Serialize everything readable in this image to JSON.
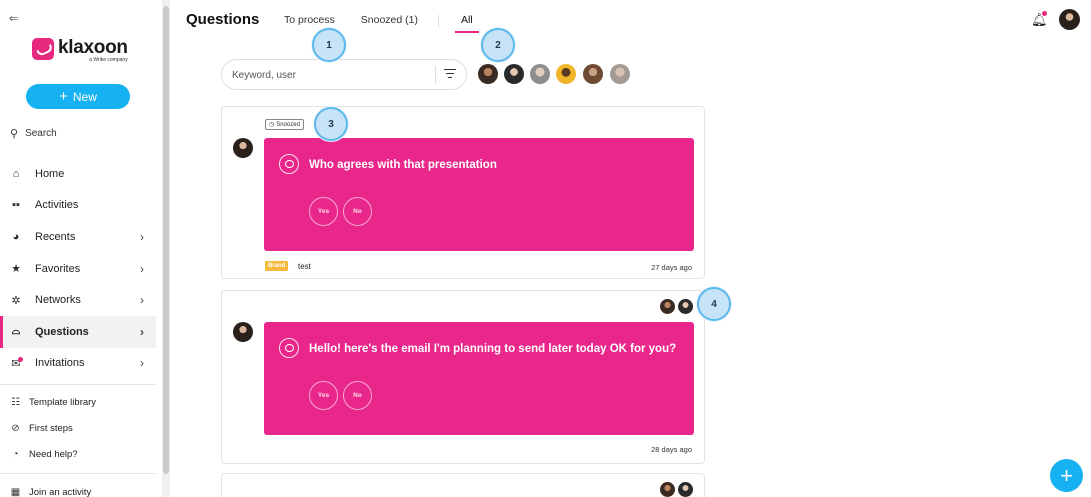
{
  "sidebar": {
    "collapse_icon": "collapse-left-icon",
    "logo": {
      "word": "klaxoon",
      "sub": "a Wrike company"
    },
    "new_label": "New",
    "search_label": "Search",
    "items": [
      {
        "label": "Home",
        "icon": "home-icon",
        "chevron": false
      },
      {
        "label": "Activities",
        "icon": "activities-icon",
        "chevron": false
      },
      {
        "label": "Recents",
        "icon": "clock-icon",
        "chevron": true
      },
      {
        "label": "Favorites",
        "icon": "star-icon",
        "chevron": true
      },
      {
        "label": "Networks",
        "icon": "network-icon",
        "chevron": true
      },
      {
        "label": "Questions",
        "icon": "inbox-icon",
        "chevron": true,
        "active": true
      },
      {
        "label": "Invitations",
        "icon": "envelope-icon",
        "chevron": true
      }
    ],
    "secondary": [
      {
        "label": "Template library",
        "icon": "template-icon"
      },
      {
        "label": "First steps",
        "icon": "compass-icon"
      },
      {
        "label": "Need help?",
        "icon": "help-icon"
      }
    ],
    "join_label": "Join an activity"
  },
  "header": {
    "title": "Questions",
    "tabs": [
      {
        "label": "To process"
      },
      {
        "label": "Snoozed (1)"
      },
      {
        "label": "All",
        "active": true
      }
    ]
  },
  "search": {
    "placeholder": "Keyword, user"
  },
  "markers": [
    "1",
    "2",
    "3",
    "4"
  ],
  "cards": [
    {
      "snoozed_label": "Snoozed",
      "question": "Who agrees with that presentation",
      "answers": [
        "Yes",
        "No"
      ],
      "badge": "Brand",
      "tag": "test",
      "time": "27 days ago"
    },
    {
      "question": "Hello! here's the email I'm planning to send later today OK for you?",
      "answers": [
        "Yes",
        "No"
      ],
      "time": "28 days ago"
    }
  ],
  "colors": {
    "accent": "#e6297f",
    "question_bg": "#e9278a",
    "primary": "#16b1f0",
    "brand_badge": "#f5b93c"
  }
}
